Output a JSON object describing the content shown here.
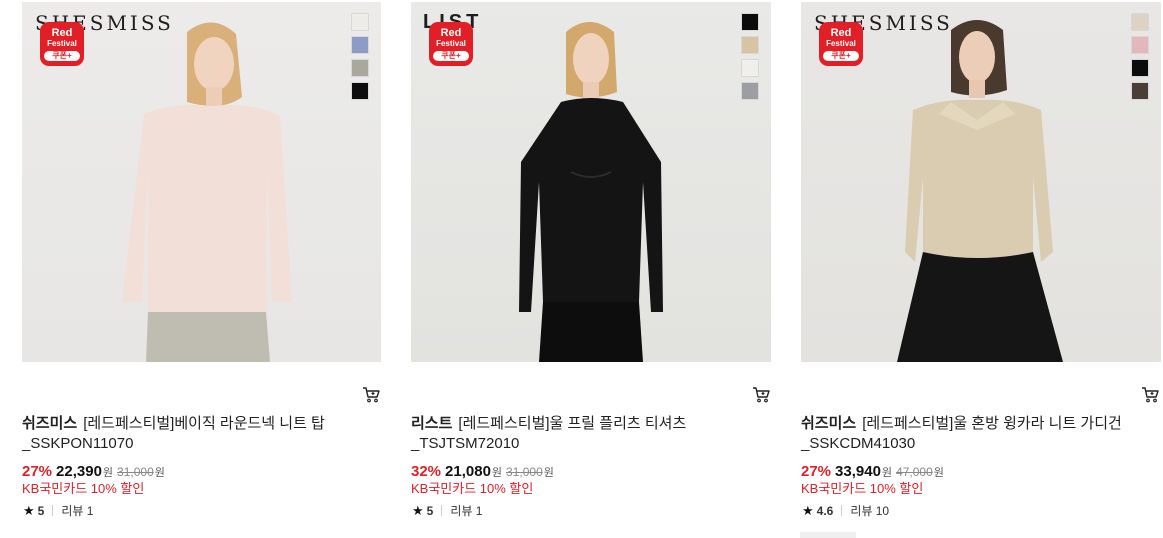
{
  "products": [
    {
      "logo": "SHESMISS",
      "badge": {
        "line1": "Red",
        "line2": "Festival",
        "line3": "쿠폰+"
      },
      "swatches": [
        "#eeece6",
        "#8c9cc7",
        "#aaa79f",
        "#0c0c0c"
      ],
      "brand": "쉬즈미스",
      "name": "[레드페스티벌]베이직 라운드넥 니트 탑",
      "code": "_SSKPON11070",
      "discount": "27%",
      "price": "22,390",
      "won": "원",
      "original_price": "31,000",
      "original_won": "원",
      "card_promo": "KB국민카드 10% 할인",
      "rating": "5",
      "reviews": "리뷰 1"
    },
    {
      "logo": "LIST",
      "badge": {
        "line1": "Red",
        "line2": "Festival",
        "line3": "쿠폰+"
      },
      "swatches": [
        "#0b0b0b",
        "#d8c4a5",
        "#f1efeb",
        "#9c9ea3"
      ],
      "brand": "리스트",
      "name": "[레드페스티벌]울 프릴 플리츠 티셔츠",
      "code": "_TSJTSM72010",
      "discount": "32%",
      "price": "21,080",
      "won": "원",
      "original_price": "31,000",
      "original_won": "원",
      "card_promo": "KB국민카드 10% 할인",
      "rating": "5",
      "reviews": "리뷰 1"
    },
    {
      "logo": "SHESMISS",
      "badge": {
        "line1": "Red",
        "line2": "Festival",
        "line3": "쿠폰+"
      },
      "swatches": [
        "#ddd3c4",
        "#e2b8bd",
        "#0c0c0c",
        "#4b3d37"
      ],
      "brand": "쉬즈미스",
      "name": "[레드페스티벌]울 혼방 윙카라 니트 가디건",
      "code": "_SSKCDM41030",
      "discount": "27%",
      "price": "33,940",
      "won": "원",
      "original_price": "47,000",
      "original_won": "원",
      "card_promo": "KB국민카드 10% 할인",
      "rating": "4.6",
      "reviews": "리뷰 10"
    }
  ],
  "icons": {
    "cart": "cart-icon",
    "star": "star-icon"
  },
  "colors": {
    "accent": "#e21f26",
    "text": "#222222",
    "muted": "#888888"
  }
}
